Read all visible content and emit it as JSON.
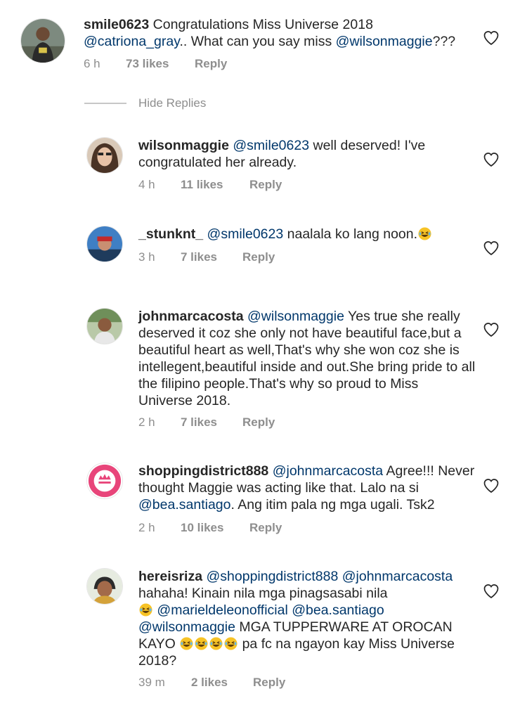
{
  "colors": {
    "text": "#262626",
    "mention": "#00376b",
    "meta": "#8e8e8e"
  },
  "top_comment": {
    "username": "smile0623",
    "text_start": "Congratulations Miss Universe 2018",
    "mention1": "@catriona_gray",
    "text_mid": ".. What can you say miss ",
    "mention2": "@wilsonmaggie",
    "text_end": "???",
    "time": "6 h",
    "likes": "73 likes",
    "reply": "Reply"
  },
  "hide_replies": "Hide Replies",
  "replies": [
    {
      "username": "wilsonmaggie",
      "mention": "@smile0623",
      "text": " well deserved! I've congratulated her already.",
      "time": "4 h",
      "likes": "11 likes",
      "reply": "Reply"
    },
    {
      "username": "_stunknt_",
      "mention": "@smile0623",
      "text": " naalala ko lang noon.",
      "emoji": "laughing-emoji",
      "time": "3 h",
      "likes": "7 likes",
      "reply": "Reply"
    },
    {
      "username": "johnmarcacosta",
      "mention": "@wilsonmaggie",
      "text": " Yes true she really deserved it coz she only not have beautiful face,but a beautiful heart as well,That's why she won coz she is intellegent,beautiful inside and out.She bring pride to all the filipino people.That's why so proud to Miss Universe 2018.",
      "time": "2 h",
      "likes": "7 likes",
      "reply": "Reply"
    },
    {
      "username": "shoppingdistrict888",
      "mention1": "@johnmarcacosta",
      "text1": " Agree!!! Never thought Maggie was acting like that. Lalo na si ",
      "mention2": "@bea.santiago",
      "text2": ". Ang itim pala ng mga ugali. Tsk2",
      "time": "2 h",
      "likes": "10 likes",
      "reply": "Reply"
    },
    {
      "username": "hereisriza",
      "mention1": "@shoppingdistrict888",
      "mention2": "@johnmarcacosta",
      "text1": "hahaha! Kinain nila mga pinagsasabi nila",
      "mention3": "@marieldeleonofficial",
      "mention4": "@bea.santiago",
      "mention5": "@wilsonmaggie",
      "text2": " MGA TUPPERWARE AT OROCAN KAYO",
      "text3": " pa fc na ngayon kay Miss Universe 2018?",
      "time": "39 m",
      "likes": "2 likes",
      "reply": "Reply"
    }
  ],
  "icons": {
    "like": "heart-icon",
    "emoji": "laughing-emoji"
  }
}
